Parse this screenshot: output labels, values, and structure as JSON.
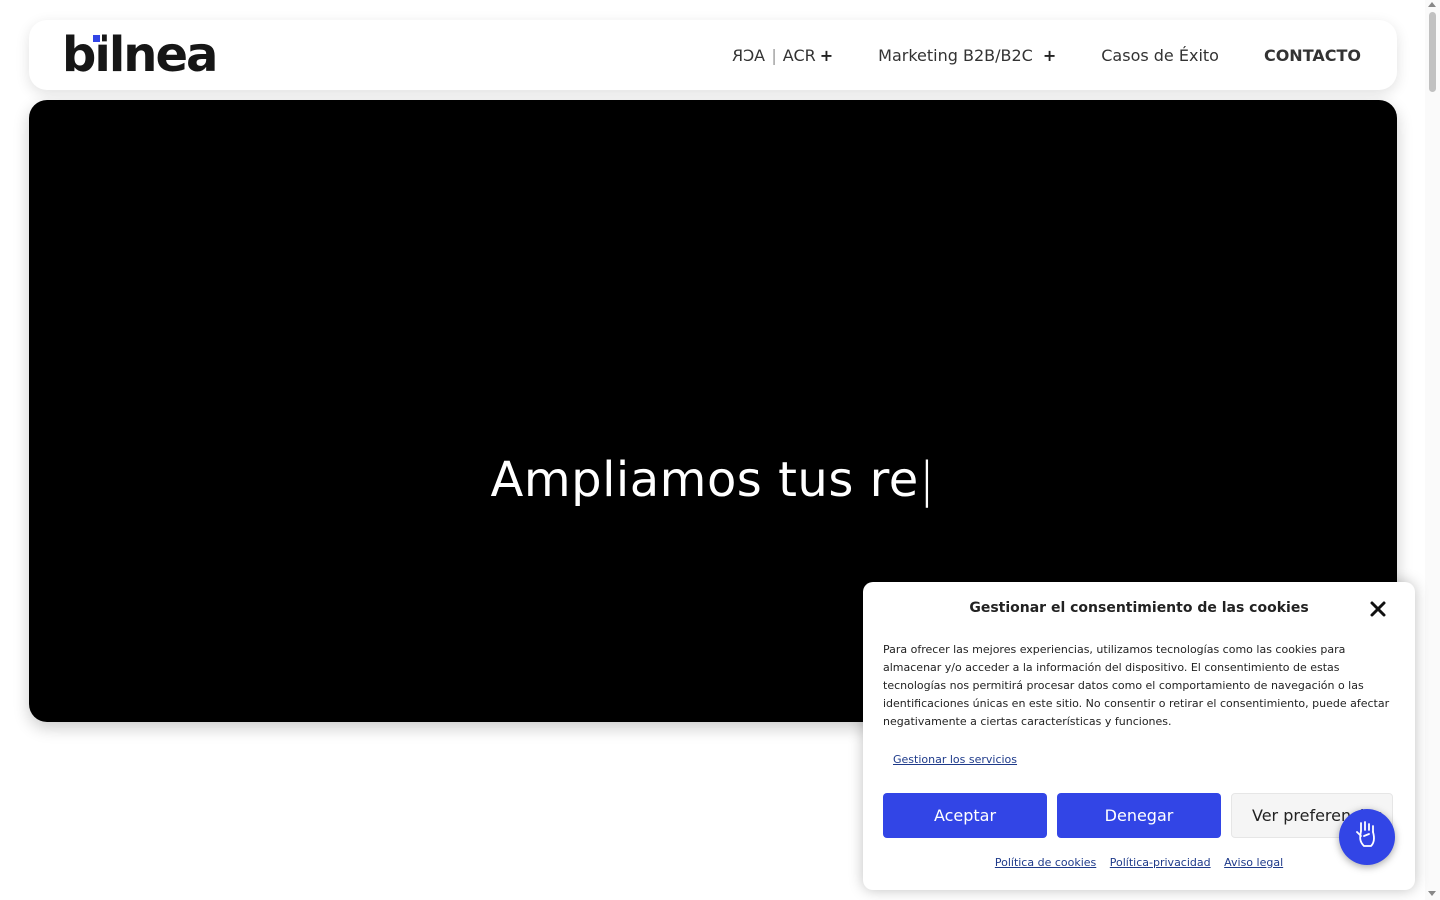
{
  "header": {
    "logo_text": "bilnea",
    "nav": {
      "aca_left": "ACR",
      "aca_sep": "|",
      "aca_right": "ACR",
      "aca_plus": "+",
      "marketing": "Marketing B2B/B2C",
      "marketing_plus": "+",
      "casos": "Casos de Éxito",
      "contacto": "CONTACTO"
    }
  },
  "hero": {
    "text": "Ampliamos tus re",
    "cursor": "|"
  },
  "cookie": {
    "title": "Gestionar el consentimiento de las cookies",
    "body": "Para ofrecer las mejores experiencias, utilizamos tecnologías como las cookies para almacenar y/o acceder a la información del dispositivo. El consentimiento de estas tecnologías nos permitirá procesar datos como el comportamiento de navegación o las identificaciones únicas en este sitio. No consentir o retirar el consentimiento, puede afectar negativamente a ciertas características y funciones.",
    "manage_link": "Gestionar los servicios",
    "accept": "Aceptar",
    "deny": "Denegar",
    "preferences": "Ver preferencias",
    "links": [
      "Política de cookies",
      "Política-privacidad",
      "Aviso legal"
    ]
  },
  "colors": {
    "accent": "#3245e6",
    "hero_bg": "#000000"
  },
  "icons": {
    "close": "close-icon",
    "accessibility": "sign-language-icon"
  }
}
